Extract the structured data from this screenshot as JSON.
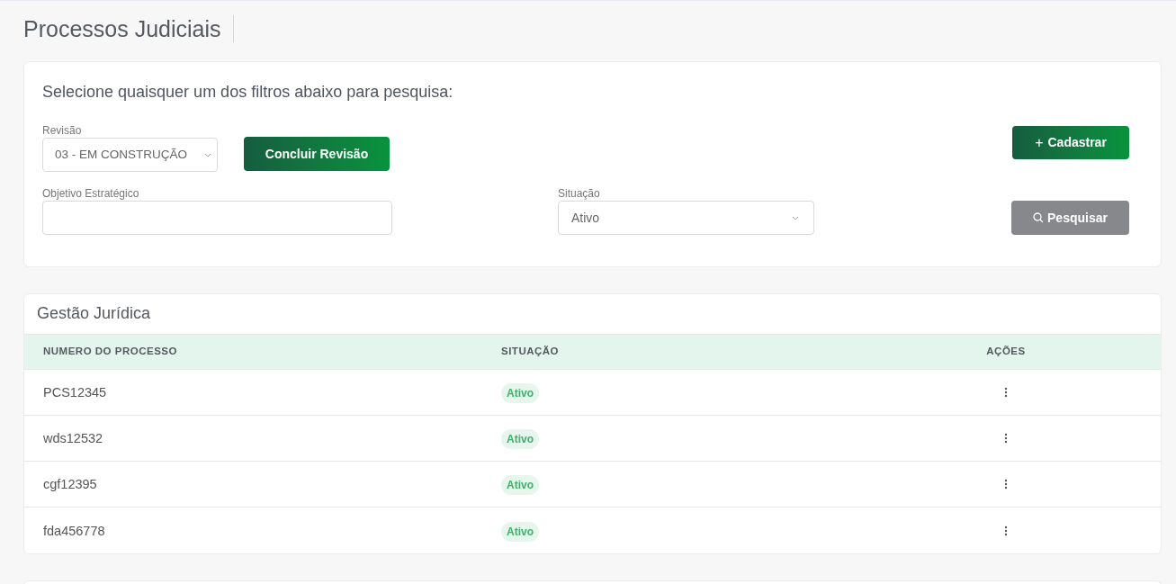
{
  "page_title": "Processos Judiciais",
  "filters": {
    "heading": "Selecione quaisquer um dos filtros abaixo para pesquisa:",
    "revision": {
      "label": "Revisão",
      "value": "03 - EM CONSTRUÇÃO"
    },
    "conclude_button": "Concluir Revisão",
    "create_button": {
      "icon": "+",
      "label": "Cadastrar"
    },
    "objective": {
      "label": "Objetivo Estratégico"
    },
    "situation": {
      "label": "Situação",
      "value": "Ativo"
    },
    "search_button": "Pesquisar"
  },
  "table": {
    "title": "Gestão Jurídica",
    "columns": [
      "NUMERO DO PROCESSO",
      "SITUAÇÃO",
      "AÇÕES"
    ],
    "rows": [
      {
        "number": "PCS12345",
        "status": "Ativo"
      },
      {
        "number": "wds12532",
        "status": "Ativo"
      },
      {
        "number": "cgf12395",
        "status": "Ativo"
      },
      {
        "number": "fda456778",
        "status": "Ativo"
      }
    ]
  }
}
